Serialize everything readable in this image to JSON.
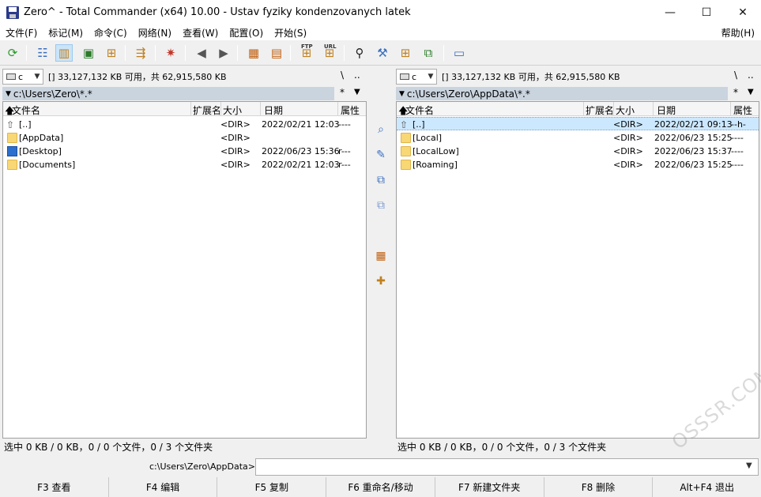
{
  "window": {
    "title": "Zero^ - Total Commander (x64) 10.00 - Ustav fyziky kondenzovanych latek",
    "minimize": "—",
    "maximize": "☐",
    "close": "✕"
  },
  "menu": {
    "items": [
      "文件(F)",
      "标记(M)",
      "命令(C)",
      "网络(N)",
      "查看(W)",
      "配置(O)",
      "开始(S)"
    ],
    "help": "帮助(H)"
  },
  "left": {
    "drive": "c",
    "drive_info": "[]  33,127,132 KB 可用，共 62,915,580 KB",
    "nav_root": "\\",
    "nav_up": "..",
    "path": "c:\\Users\\Zero\\*.*",
    "path_filter": "*",
    "headers": {
      "name": "文件名",
      "ext": "扩展名",
      "size": "大小",
      "date": "日期",
      "attr": "属性"
    },
    "rows": [
      {
        "icon": "up-dir-icon",
        "name": "[..]",
        "size": "<DIR>",
        "date": "2022/02/21 12:03",
        "attr": "----"
      },
      {
        "icon": "folder-icon",
        "name": "[AppData]",
        "size": "<DIR>",
        "date": "",
        "attr": ""
      },
      {
        "icon": "desktop-icon",
        "name": "[Desktop]",
        "size": "<DIR>",
        "date": "2022/06/23 15:36",
        "attr": "r---"
      },
      {
        "icon": "folder-icon",
        "name": "[Documents]",
        "size": "<DIR>",
        "date": "2022/02/21 12:03",
        "attr": "r---"
      }
    ],
    "status": "选中 0 KB / 0 KB，0 / 0 个文件，0 / 3 个文件夹"
  },
  "right": {
    "drive": "c",
    "drive_info": "[]  33,127,132 KB 可用，共 62,915,580 KB",
    "nav_root": "\\",
    "nav_up": "..",
    "path": "c:\\Users\\Zero\\AppData\\*.*",
    "path_filter": "*",
    "headers": {
      "name": "文件名",
      "ext": "扩展名",
      "size": "大小",
      "date": "日期",
      "attr": "属性"
    },
    "rows": [
      {
        "icon": "up-dir-icon",
        "name": "[..]",
        "size": "<DIR>",
        "date": "2022/02/21 09:13",
        "attr": "--h-",
        "selected": true
      },
      {
        "icon": "folder-icon",
        "name": "[Local]",
        "size": "<DIR>",
        "date": "2022/06/23 15:25",
        "attr": "----"
      },
      {
        "icon": "folder-icon",
        "name": "[LocalLow]",
        "size": "<DIR>",
        "date": "2022/06/23 15:37",
        "attr": "----"
      },
      {
        "icon": "folder-icon",
        "name": "[Roaming]",
        "size": "<DIR>",
        "date": "2022/06/23 15:25",
        "attr": "----"
      }
    ],
    "status": "选中 0 KB / 0 KB，0 / 0 个文件，0 / 3 个文件夹"
  },
  "cmd": {
    "label": "c:\\Users\\Zero\\AppData>",
    "value": ""
  },
  "fkeys": [
    "F3 查看",
    "F4 编辑",
    "F5 复制",
    "F6 重命名/移动",
    "F7 新建文件夹",
    "F8 删除",
    "Alt+F4 退出"
  ],
  "toolbar": {
    "ftp_label": "FTP",
    "url_label": "URL"
  },
  "watermark": "OSSSR.COM",
  "colors": {
    "selection": "#cce8ff",
    "path_active": "#cfd8e4",
    "path_inactive": "#cad4df",
    "folder": "#f8d775"
  }
}
